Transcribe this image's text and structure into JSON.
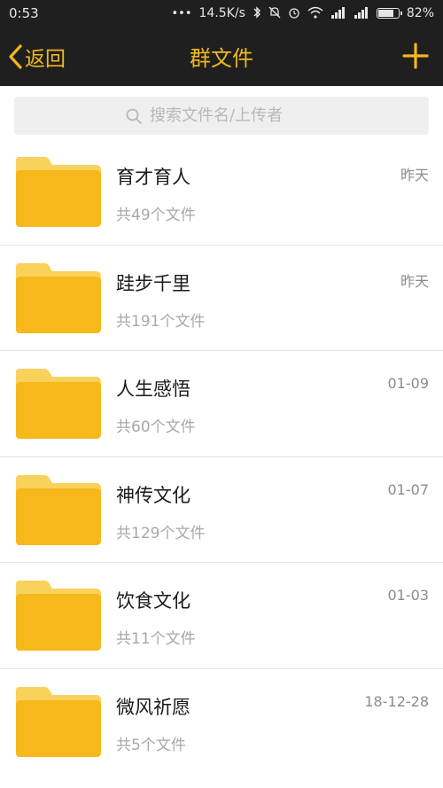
{
  "status_bar": {
    "time": "0:53",
    "speed": "14.5K/s",
    "battery": "82%",
    "battery_level": 0.82
  },
  "nav": {
    "back_label": "返回",
    "title": "群文件"
  },
  "search": {
    "placeholder": "搜索文件名/上传者"
  },
  "folders": [
    {
      "name": "育才育人",
      "count": "共49个文件",
      "date": "昨天"
    },
    {
      "name": "跬步千里",
      "count": "共191个文件",
      "date": "昨天"
    },
    {
      "name": "人生感悟",
      "count": "共60个文件",
      "date": "01-09"
    },
    {
      "name": "神传文化",
      "count": "共129个文件",
      "date": "01-07"
    },
    {
      "name": "饮食文化",
      "count": "共11个文件",
      "date": "01-03"
    },
    {
      "name": "微风祈愿",
      "count": "共5个文件",
      "date": "18-12-28"
    }
  ],
  "colors": {
    "accent": "#f0b81e",
    "bar": "#1f1f1f",
    "folder_body": "#f6b81a",
    "folder_tab": "#f9d25c"
  }
}
